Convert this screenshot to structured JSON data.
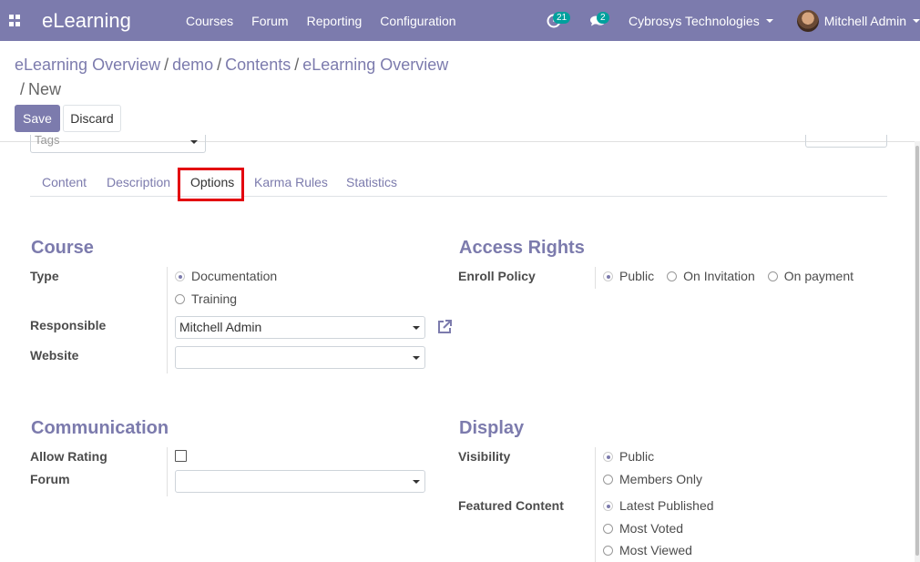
{
  "navbar": {
    "app_title": "eLearning",
    "menu": [
      "Courses",
      "Forum",
      "Reporting",
      "Configuration"
    ],
    "activity_count": "21",
    "message_count": "2",
    "company": "Cybrosys Technologies",
    "user": "Mitchell Admin"
  },
  "breadcrumb": {
    "items": [
      "eLearning Overview",
      "demo",
      "Contents",
      "eLearning Overview"
    ],
    "current": "New"
  },
  "buttons": {
    "save": "Save",
    "discard": "Discard"
  },
  "partial_field": {
    "placeholder": "Tags"
  },
  "tabs": [
    "Content",
    "Description",
    "Options",
    "Karma Rules",
    "Statistics"
  ],
  "active_tab": "Options",
  "course": {
    "title": "Course",
    "type_label": "Type",
    "type_options": [
      "Documentation",
      "Training"
    ],
    "type_selected": "Documentation",
    "responsible_label": "Responsible",
    "responsible_value": "Mitchell Admin",
    "website_label": "Website",
    "website_value": ""
  },
  "access_rights": {
    "title": "Access Rights",
    "enroll_label": "Enroll Policy",
    "enroll_options": [
      "Public",
      "On Invitation",
      "On payment"
    ],
    "enroll_selected": "Public"
  },
  "communication": {
    "title": "Communication",
    "allow_rating_label": "Allow Rating",
    "allow_rating": false,
    "forum_label": "Forum",
    "forum_value": ""
  },
  "display": {
    "title": "Display",
    "visibility_label": "Visibility",
    "visibility_options": [
      "Public",
      "Members Only"
    ],
    "visibility_selected": "Public",
    "featured_label": "Featured Content",
    "featured_options": [
      "Latest Published",
      "Most Voted",
      "Most Viewed"
    ],
    "featured_selected": "Latest Published"
  },
  "colors": {
    "brand": "#7c7bad",
    "badge": "#00a09d",
    "highlight": "#e3000f"
  }
}
